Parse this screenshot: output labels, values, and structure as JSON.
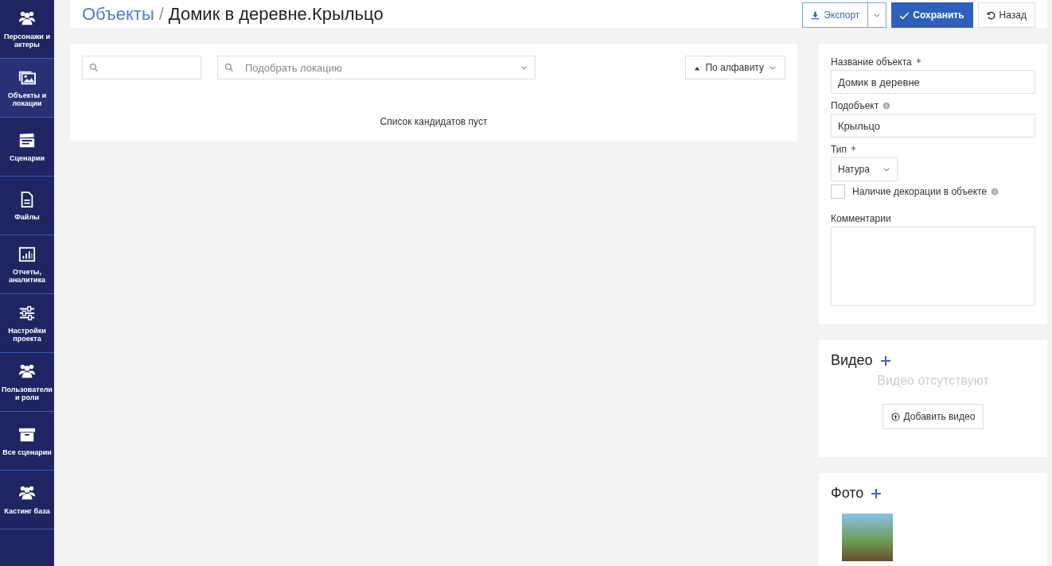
{
  "sidebar": {
    "items": [
      {
        "label": "Персонажи и актеры",
        "selected": false
      },
      {
        "label": "Объекты и локации",
        "selected": true
      },
      {
        "label": "Сценарии",
        "selected": false
      },
      {
        "label": "Файлы",
        "selected": false
      },
      {
        "label": "Отчеты, аналитика",
        "selected": false
      },
      {
        "label": "Настройки проекта",
        "selected": false
      },
      {
        "label": "Пользователи и роли",
        "selected": false
      },
      {
        "label": "Все сценарии",
        "selected": false
      },
      {
        "label": "Кастинг база",
        "selected": false
      }
    ]
  },
  "header": {
    "breadcrumb": "Объекты",
    "separator": "/",
    "title": "Домик в деревне.Крыльцо",
    "buttons": [
      {
        "kind": "export",
        "label": "Экспорт"
      },
      {
        "kind": "save",
        "label": "Сохранить"
      },
      {
        "kind": "back",
        "label": "Назад"
      }
    ]
  },
  "candidates": {
    "location": {
      "placeholder": "Подобрать локацию"
    },
    "sort": {
      "label": "По алфавиту"
    },
    "empty_text": "Список кандидатов пуст"
  },
  "form": {
    "fields": [
      {
        "kind": "text",
        "label": "Название объекта",
        "required": true,
        "info": false,
        "value": "Домик в деревне"
      },
      {
        "kind": "text",
        "label": "Подобъект",
        "required": false,
        "info": true,
        "value": "Крыльцо"
      },
      {
        "kind": "select",
        "label": "Тип",
        "required": true,
        "info": false,
        "value": "Натура"
      },
      {
        "kind": "checkbox",
        "label": "Наличие декорации в объекте",
        "info": true,
        "checked": false
      },
      {
        "kind": "textarea",
        "label": "Комментарии",
        "required": false,
        "info": false
      }
    ]
  },
  "video": {
    "title": "Видео",
    "empty_text": "Видео отсутствуют",
    "add_button": "Добавить видео"
  },
  "photo": {
    "title": "Фото"
  }
}
